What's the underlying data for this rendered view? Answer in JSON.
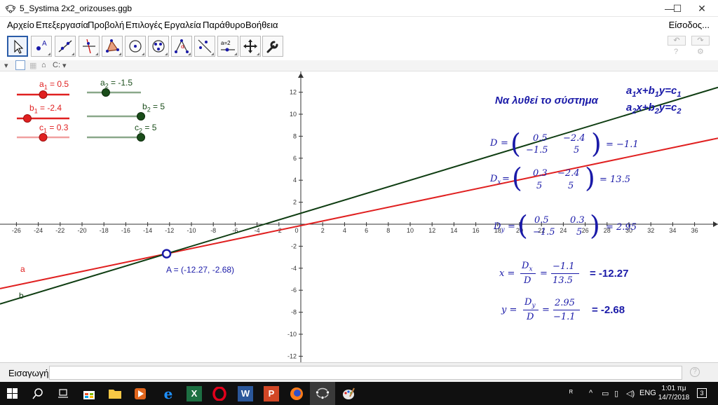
{
  "window": {
    "title": "5_Systima 2x2_orizouses.ggb",
    "minimize": "—",
    "maximize": "☐",
    "close": "✕"
  },
  "menu": {
    "items": [
      "Αρχείο",
      "Επεξεργασία",
      "Προβολή",
      "Επιλογές",
      "Εργαλεία",
      "Παράθυρο",
      "Βοήθεια"
    ],
    "signin": "Είσοδος..."
  },
  "toolbar": {
    "tools": [
      "move-tool",
      "point-tool",
      "line-tool",
      "perpendicular-line-tool",
      "polygon-tool",
      "circle-tool",
      "conic-tool",
      "angle-tool",
      "reflect-tool",
      "slider-tool",
      "move-graphics-view-tool",
      "tools-settings"
    ],
    "slider_tool_text": "a=2",
    "undo": "↶",
    "redo": "↷",
    "help": "?",
    "settings": "⚙"
  },
  "stylebar": {
    "axes_option": "C:"
  },
  "sliders": [
    {
      "name": "a",
      "sub": "1",
      "value": "0.5",
      "color": "#e02020",
      "knob": 0.5
    },
    {
      "name": "b",
      "sub": "1",
      "value": "-2.4",
      "color": "#e02020",
      "knob": 0.2
    },
    {
      "name": "c",
      "sub": "1",
      "value": "0.3",
      "color": "#e02020",
      "knob": 0.5
    },
    {
      "name": "a",
      "sub": "2",
      "value": "-1.5",
      "color": "#1a4d1a",
      "knob": 0.35
    },
    {
      "name": "b",
      "sub": "2",
      "value": "5",
      "color": "#1a4d1a",
      "knob": 1.0
    },
    {
      "name": "c",
      "sub": "2",
      "value": "5",
      "color": "#1a4d1a",
      "knob": 1.0
    }
  ],
  "graph": {
    "x_ticks": [
      "-26",
      "-24",
      "-22",
      "-20",
      "-18",
      "-16",
      "-14",
      "-12",
      "-10",
      "-8",
      "-6",
      "-4",
      "-2",
      "0",
      "2",
      "4",
      "6",
      "8",
      "10",
      "12",
      "14",
      "16",
      "18",
      "20",
      "22",
      "24",
      "26",
      "28",
      "30",
      "32",
      "34",
      "36"
    ],
    "y_ticks": [
      "12",
      "10",
      "8",
      "6",
      "4",
      "2",
      "-2",
      "-4",
      "-6",
      "-8",
      "-10",
      "-12"
    ],
    "line_a": {
      "label": "a",
      "color": "#e02020"
    },
    "line_b": {
      "label": "b",
      "color": "#0f3d12"
    },
    "point": {
      "label": "A = (-12.27, -2.68)",
      "x": -12.27,
      "y": -2.68,
      "color": "#1a1aa8"
    }
  },
  "text": {
    "heading": "Να λυθεί το σύστημα",
    "eq1": {
      "a": "a",
      "a_sub": "1",
      "xb": "x+b",
      "b_sub": "1",
      "yc": "y=c",
      "c_sub": "1"
    },
    "eq2": {
      "a": "a",
      "a_sub": "2",
      "xb": "x+b",
      "b_sub": "2",
      "yc": "y=c",
      "c_sub": "2"
    },
    "D": {
      "name": "D",
      "m11": "0.5",
      "m12": "−2.4",
      "m21": "−1.5",
      "m22": "5",
      "result": "= −1.1"
    },
    "Dx": {
      "name": "D",
      "sub": "x",
      "m11": "0.3",
      "m12": "−2.4",
      "m21": "5",
      "m22": "5",
      "result": "= 13.5"
    },
    "Dy": {
      "name": "D",
      "sub": "y",
      "m11": "0.5",
      "m12": "0.3",
      "m21": "−1.5",
      "m22": "5",
      "result": "= 2.95"
    },
    "x_frac": {
      "lhs": "x =",
      "num": "D",
      "num_sub": "x",
      "den": "D",
      "eq": "=",
      "num2": "−1.1",
      "den2": "13.5"
    },
    "y_frac": {
      "lhs": "y =",
      "num": "D",
      "num_sub": "y",
      "den": "D",
      "eq": "=",
      "num2": "2.95",
      "den2": "−1.1"
    },
    "x_result": "= -12.27",
    "y_result": "= -2.68"
  },
  "input": {
    "label": "Εισαγωγή:",
    "value": "",
    "help": "?"
  },
  "taskbar": {
    "apps": [
      "start-icon",
      "search-icon",
      "task-view-icon",
      "store-icon",
      "file-explorer-icon",
      "media-player-icon",
      "edge-icon",
      "excel-icon",
      "opera-icon",
      "word-icon",
      "powerpoint-icon",
      "firefox-icon",
      "geogebra-icon",
      "paint-icon"
    ],
    "excel": "X",
    "word": "W",
    "powerpoint": "P",
    "lang": "ENG",
    "time": "1:01 πμ",
    "date": "14/7/2018",
    "notifications": "3"
  }
}
